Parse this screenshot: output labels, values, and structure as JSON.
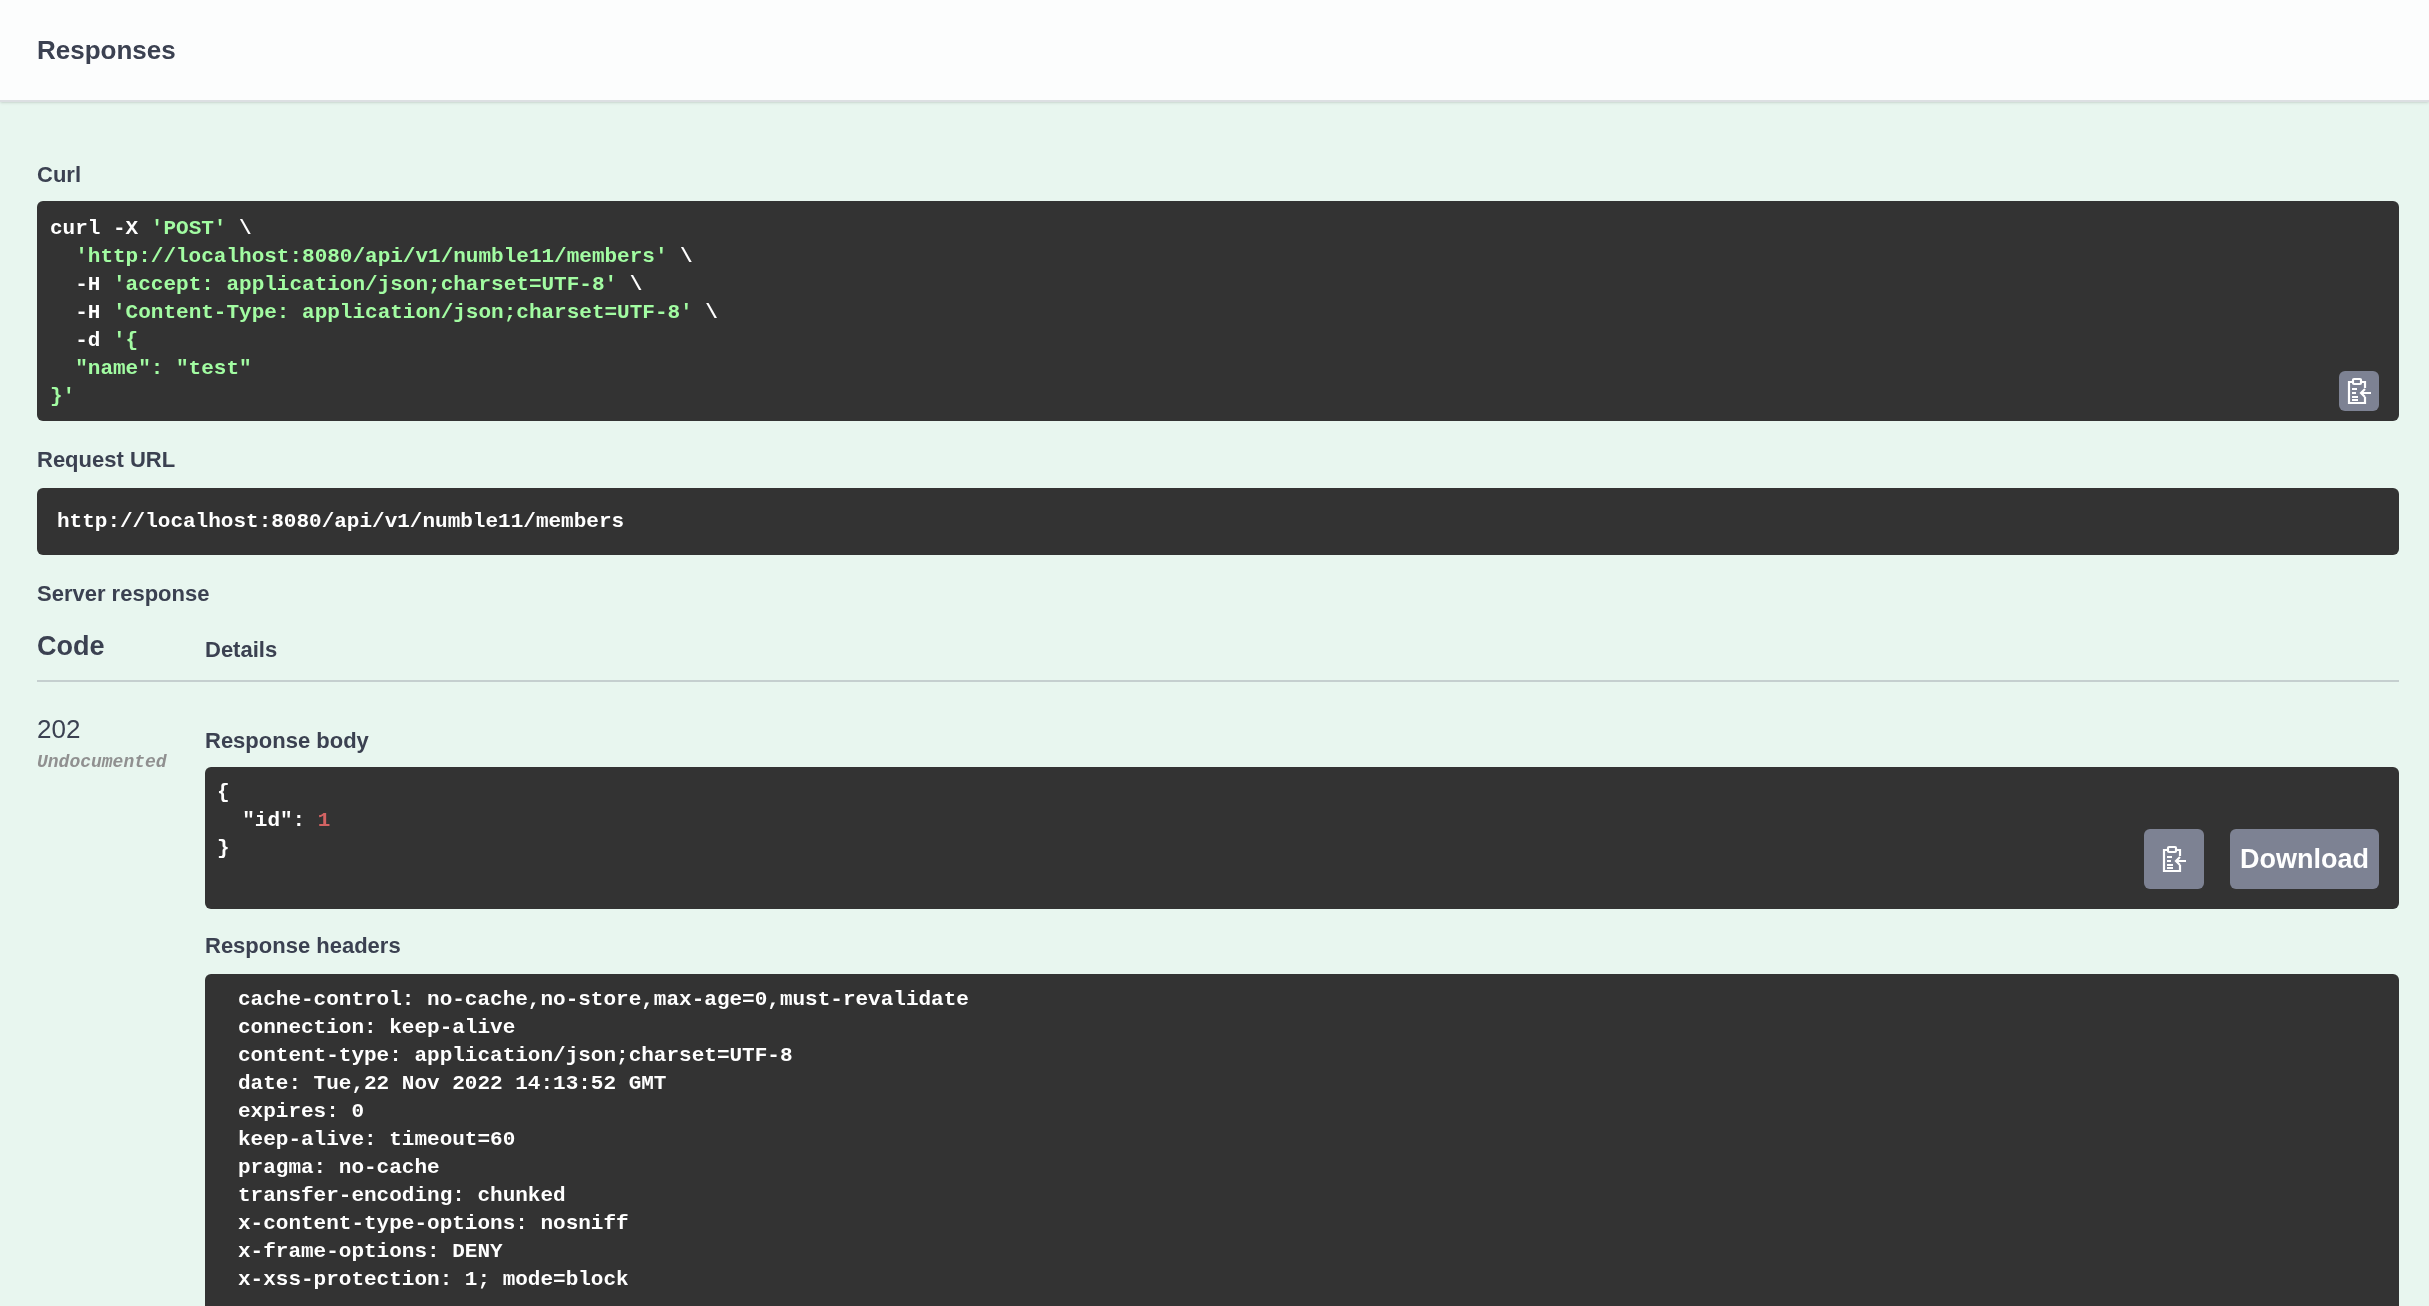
{
  "header": {
    "title": "Responses"
  },
  "curl": {
    "label": "Curl",
    "lines": [
      [
        {
          "kind": "plain",
          "text": "curl -X "
        },
        {
          "kind": "string",
          "text": "'POST'"
        },
        {
          "kind": "plain",
          "text": " \\"
        }
      ],
      [
        {
          "kind": "string",
          "text": "  'http://localhost:8080/api/v1/numble11/members'"
        },
        {
          "kind": "plain",
          "text": " \\"
        }
      ],
      [
        {
          "kind": "plain",
          "text": "  -H "
        },
        {
          "kind": "string",
          "text": "'accept: application/json;charset=UTF-8'"
        },
        {
          "kind": "plain",
          "text": " \\"
        }
      ],
      [
        {
          "kind": "plain",
          "text": "  -H "
        },
        {
          "kind": "string",
          "text": "'Content-Type: application/json;charset=UTF-8'"
        },
        {
          "kind": "plain",
          "text": " \\"
        }
      ],
      [
        {
          "kind": "plain",
          "text": "  -d "
        },
        {
          "kind": "string",
          "text": "'{"
        }
      ],
      [
        {
          "kind": "string",
          "text": "  \"name\": \"test\""
        }
      ],
      [
        {
          "kind": "string",
          "text": "}'"
        }
      ]
    ]
  },
  "request_url": {
    "label": "Request URL",
    "value": "http://localhost:8080/api/v1/numble11/members"
  },
  "server_response": {
    "label": "Server response",
    "columns": [
      "Code",
      "Details"
    ],
    "code": "202",
    "code_note": "Undocumented",
    "body": {
      "label": "Response body",
      "lines": [
        [
          {
            "kind": "plain",
            "text": "{"
          }
        ],
        [
          {
            "kind": "plain",
            "text": "  \"id\": "
          },
          {
            "kind": "number",
            "text": "1"
          }
        ],
        [
          {
            "kind": "plain",
            "text": "}"
          }
        ]
      ],
      "download": "Download"
    },
    "headers": {
      "label": "Response headers",
      "lines": [
        "cache-control: no-cache,no-store,max-age=0,must-revalidate",
        "connection: keep-alive",
        "content-type: application/json;charset=UTF-8",
        "date: Tue,22 Nov 2022 14:13:52 GMT",
        "expires: 0",
        "keep-alive: timeout=60",
        "pragma: no-cache",
        "transfer-encoding: chunked",
        "x-content-type-options: nosniff",
        "x-frame-options: DENY",
        "x-xss-protection: 1; mode=block"
      ]
    }
  }
}
